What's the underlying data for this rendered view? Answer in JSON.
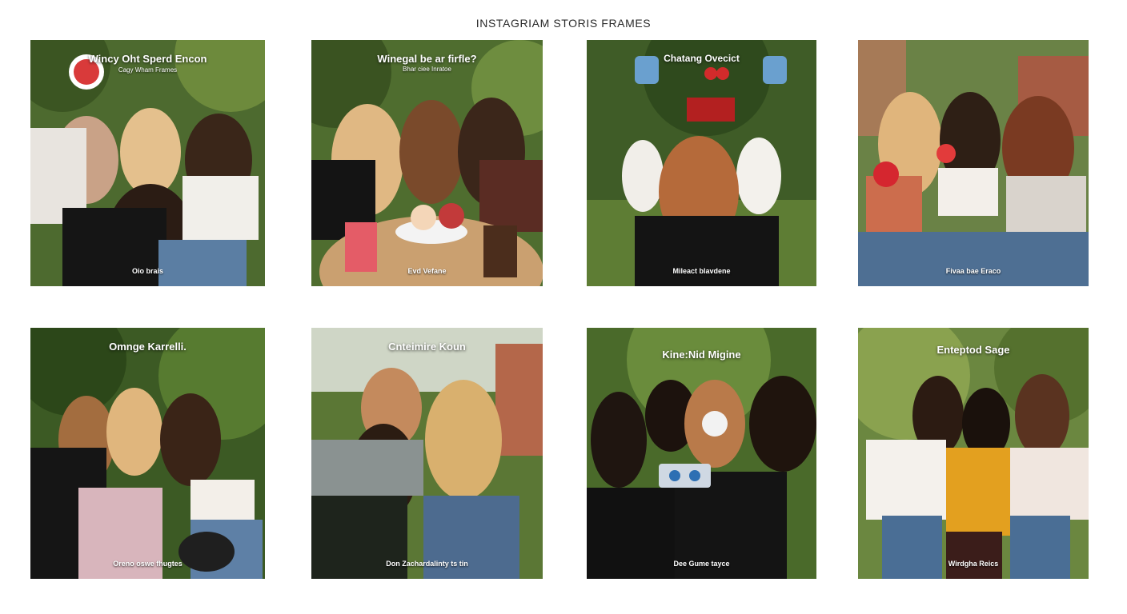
{
  "page": {
    "title": "INSTAGRIAM STORIS FRAMES"
  },
  "frames": [
    {
      "title": "Wincy Oht Sperd Encon",
      "subtitle": "Cagy Wham Frames",
      "caption": "Oio brais"
    },
    {
      "title": "Winegal be ar firfle?",
      "subtitle": "Bhar ciee Inratoe",
      "caption": "Evd Vefane"
    },
    {
      "title": "Chatang Ovecict",
      "subtitle": "",
      "caption": "Mileact blavdene"
    },
    {
      "title": "",
      "subtitle": "",
      "caption": "Fivaa bae Eraco"
    },
    {
      "title": "Omnge Karrelli.",
      "subtitle": "",
      "caption": "Oreno oswe fhugtes"
    },
    {
      "title": "Cnteimire Koun",
      "subtitle": "",
      "caption": "Don Zachardalinty ts tin"
    },
    {
      "title": "Kine:Nid Migine",
      "subtitle": "",
      "caption": "Dee Gume tayce"
    },
    {
      "title": "Enteptod Sage",
      "subtitle": "",
      "caption": "Wirdgha Reics"
    }
  ]
}
